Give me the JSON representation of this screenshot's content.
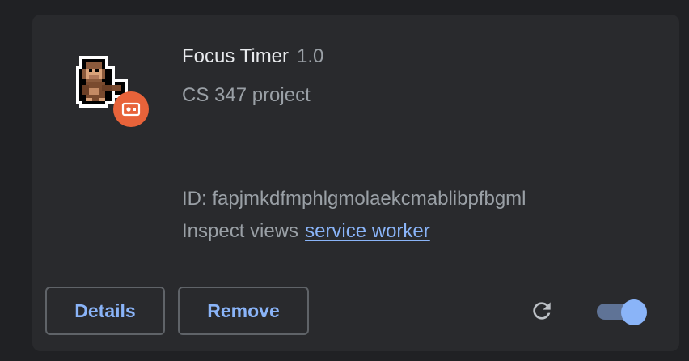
{
  "extension": {
    "name": "Focus Timer",
    "version": "1.0",
    "description": "CS 347 project",
    "id_label": "ID: fapjmkdfmphlgmolaekcmablibpfbgml",
    "inspect_label": "Inspect views",
    "inspect_link": "service worker",
    "enabled": true
  },
  "buttons": {
    "details": "Details",
    "remove": "Remove"
  },
  "icons": {
    "extension": "pixel-monkey-icon",
    "badge": "unpacked-extension-icon",
    "reload": "reload-icon",
    "toggle": "toggle-switch"
  },
  "colors": {
    "card_bg": "#292a2d",
    "page_bg": "#202124",
    "accent": "#8ab4f8",
    "badge": "#e8633a"
  }
}
